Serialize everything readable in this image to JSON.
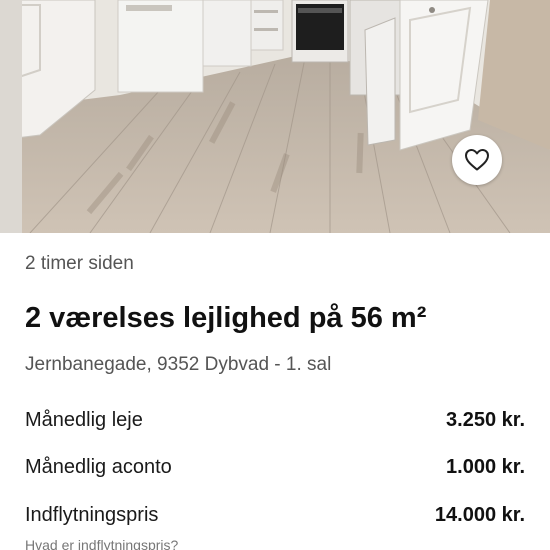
{
  "listing": {
    "posted": "2 timer siden",
    "title": "2 værelses lejlighed på 56 m²",
    "address": "Jernbanegade, 9352 Dybvad - 1. sal"
  },
  "prices": [
    {
      "label": "Månedlig leje",
      "value": "3.250 kr."
    },
    {
      "label": "Månedlig aconto",
      "value": "1.000 kr."
    },
    {
      "label": "Indflytningspris",
      "value": "14.000 kr."
    }
  ],
  "help": {
    "label": "Hvad er indflytningspris?"
  },
  "icons": {
    "favorite": "heart-outline-icon"
  }
}
